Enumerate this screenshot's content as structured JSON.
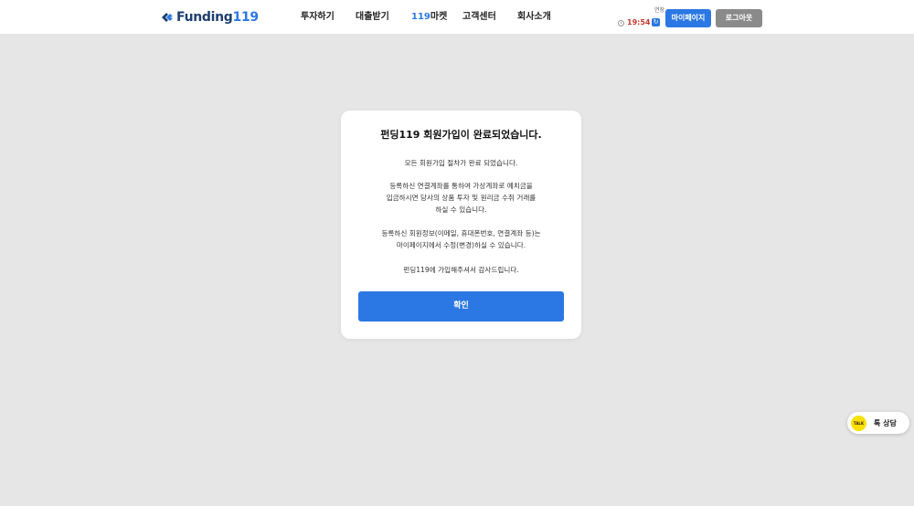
{
  "header": {
    "logo": {
      "text": "Funding",
      "number": "119"
    },
    "nav": [
      {
        "label": "투자하기"
      },
      {
        "label": "대출받기"
      },
      {
        "label_highlight": "119",
        "label": "마켓"
      },
      {
        "label": "고객센터"
      },
      {
        "label": "회사소개"
      }
    ],
    "session": {
      "time": "19:54",
      "extend_label": "연장"
    },
    "mypage_button": "마이페이지",
    "logout_button": "로그아웃"
  },
  "modal": {
    "title": "펀딩119 회원가입이 완료되었습니다.",
    "message_1": "모든 회원가입 절차가 완료 되었습니다.",
    "message_2": [
      "등록하신 연결계좌를 통하여 가상계좌로 예치금을",
      "입금하시면 당사의 상품 투자 및 원리금 수취 거래를",
      "하실 수 있습니다."
    ],
    "message_3": [
      "등록하신 회원정보(이메일, 휴대폰번호, 연결계좌 등)는",
      "마이페이지에서 수정(변경)하실 수 있습니다."
    ],
    "message_4": "펀딩119에 가입해주셔서 감사드립니다.",
    "confirm_button": "확인"
  },
  "talk_widget": {
    "icon_text": "TALK",
    "label": "톡 상담"
  },
  "colors": {
    "accent": "#2b78e4",
    "background": "#e6e6e6",
    "logout": "#8a8a8a",
    "kakao": "#f9e000"
  }
}
